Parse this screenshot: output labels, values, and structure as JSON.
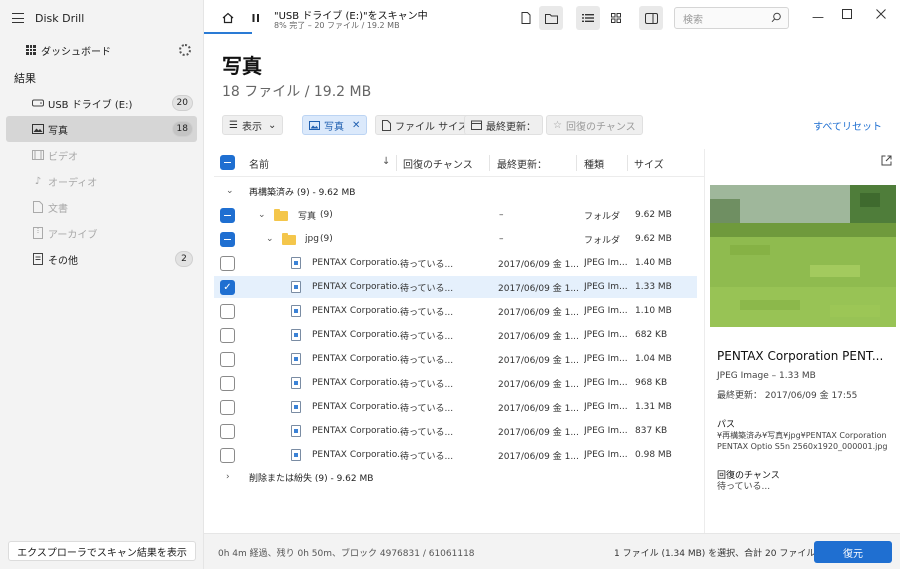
{
  "app": {
    "title": "Disk Drill"
  },
  "sidebar": {
    "dashboard_label": "ダッシュボード",
    "section_label": "結果",
    "items": [
      {
        "label": "USB ドライブ (E:)",
        "count": "20",
        "icon": "usb-drive-icon"
      },
      {
        "label": "写真",
        "count": "18",
        "icon": "photo-icon"
      },
      {
        "label": "ビデオ",
        "count": "",
        "icon": "video-icon"
      },
      {
        "label": "オーディオ",
        "count": "",
        "icon": "audio-icon"
      },
      {
        "label": "文書",
        "count": "",
        "icon": "document-icon"
      },
      {
        "label": "アーカイブ",
        "count": "",
        "icon": "archive-icon"
      },
      {
        "label": "その他",
        "count": "2",
        "icon": "other-icon"
      }
    ],
    "explorer_button": "エクスプローラでスキャン結果を表示"
  },
  "topbar": {
    "scan_title": "\"USB ドライブ (E:)\"をスキャン中",
    "scan_progress": "8% 完了 – 20 ファイル / 19.2 MB",
    "search_placeholder": "検索"
  },
  "header": {
    "title": "写真",
    "subtitle": "18 ファイル / 19.2 MB"
  },
  "filters": {
    "view_label": "表示",
    "photo_chip": "写真",
    "size_chip": "ファイル サイズ",
    "modified_chip": "最終更新：",
    "chance_chip": "回復のチャンス",
    "reset_all": "すべてリセット"
  },
  "table": {
    "columns": {
      "name": "名前",
      "chance": "回復のチャンス",
      "modified": "最終更新：",
      "type": "種類",
      "size": "サイズ"
    },
    "group_rebuilt": "再構築済み (9) - 9.62 MB",
    "group_deleted": "削除または紛失 (9) - 9.62 MB",
    "folder_photo": {
      "name": "写真",
      "count": "(9)",
      "chance": "–",
      "type": "フォルダ",
      "size": "9.62 MB"
    },
    "folder_jpg": {
      "name": "jpg",
      "count": "(9)",
      "chance": "–",
      "type": "フォルダ",
      "size": "9.62 MB"
    },
    "files": [
      {
        "name": "PENTAX Corporatio...",
        "chance": "待っている...",
        "modified": "2017/06/09 金 1...",
        "type": "JPEG Im...",
        "size": "1.40 MB",
        "checked": false
      },
      {
        "name": "PENTAX Corporatio...",
        "chance": "待っている...",
        "modified": "2017/06/09 金 1...",
        "type": "JPEG Im...",
        "size": "1.33 MB",
        "checked": true
      },
      {
        "name": "PENTAX Corporatio...",
        "chance": "待っている...",
        "modified": "2017/06/09 金 1...",
        "type": "JPEG Im...",
        "size": "1.10 MB",
        "checked": false
      },
      {
        "name": "PENTAX Corporatio...",
        "chance": "待っている...",
        "modified": "2017/06/09 金 1...",
        "type": "JPEG Im...",
        "size": "682 KB",
        "checked": false
      },
      {
        "name": "PENTAX Corporatio...",
        "chance": "待っている...",
        "modified": "2017/06/09 金 1...",
        "type": "JPEG Im...",
        "size": "1.04 MB",
        "checked": false
      },
      {
        "name": "PENTAX Corporatio...",
        "chance": "待っている...",
        "modified": "2017/06/09 金 1...",
        "type": "JPEG Im...",
        "size": "968 KB",
        "checked": false
      },
      {
        "name": "PENTAX Corporatio...",
        "chance": "待っている...",
        "modified": "2017/06/09 金 1...",
        "type": "JPEG Im...",
        "size": "1.31 MB",
        "checked": false
      },
      {
        "name": "PENTAX Corporatio...",
        "chance": "待っている...",
        "modified": "2017/06/09 金 1...",
        "type": "JPEG Im...",
        "size": "837 KB",
        "checked": false
      },
      {
        "name": "PENTAX Corporatio...",
        "chance": "待っている...",
        "modified": "2017/06/09 金 1...",
        "type": "JPEG Im...",
        "size": "0.98 MB",
        "checked": false
      }
    ]
  },
  "preview": {
    "name": "PENTAX Corporation PENT...",
    "type_size": "JPEG Image – 1.33 MB",
    "modified": "最終更新： 2017/06/09 金 17:55",
    "path_label": "パス",
    "path_value": "¥再構築済み¥写真¥jpg¥PENTAX Corporation PENTAX Optio S5n 2560x1920_000001.jpg",
    "chance_label": "回復のチャンス",
    "chance_value": "待っている..."
  },
  "status": {
    "left": "0h 4m 経過、残り 0h 50m、ブロック 4976831 / 61061118",
    "right": "1 ファイル (1.34 MB) を選択、合計 20 ファイル",
    "restore_button": "復元"
  },
  "colors": {
    "accent": "#1f6fd1",
    "selected_row": "#e5f0fc",
    "sidebar_bg": "#f3f3f3"
  }
}
